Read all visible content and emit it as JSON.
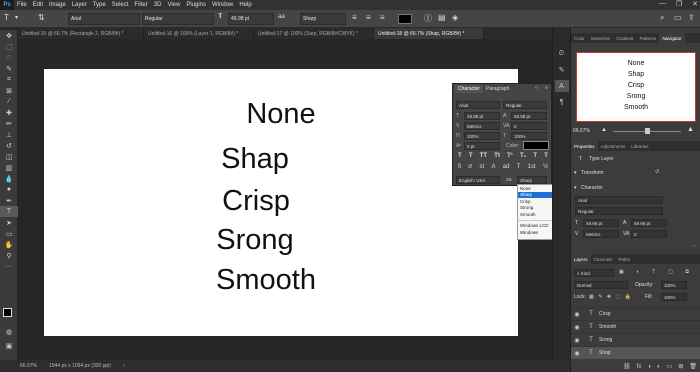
{
  "app": {
    "logo": "Ps"
  },
  "menubar": {
    "items": [
      "File",
      "Edit",
      "Image",
      "Layer",
      "Type",
      "Select",
      "Filter",
      "3D",
      "View",
      "Plugins",
      "Window",
      "Help"
    ]
  },
  "options": {
    "font_family": "Arial",
    "font_style": "Regular",
    "font_size": "49.98 pt",
    "aa_label": "aa",
    "aa_value": "Sharp"
  },
  "tabs": [
    {
      "label": "Untitled-15 @ 66.7% (Rectangle 2, RGB/8#) *"
    },
    {
      "label": "Untitled-16 @ 100% (Layer 1, RGB/8#) *"
    },
    {
      "label": "Untitled-17 @ 100% (Sarp, RGB/8#/CMYK) *"
    },
    {
      "label": "Untitled-18 @ 66.7% (Shap, RGB/8#) *"
    }
  ],
  "canvas": {
    "lines": [
      "None",
      "Shap",
      "Crisp",
      "Srong",
      "Smooth"
    ]
  },
  "status": {
    "zoom": "66.67%",
    "doc_info": "1944 px x 1094 px (300 ppi)"
  },
  "character_panel": {
    "tab_character": "Character",
    "tab_paragraph": "Paragraph",
    "font_family": "Arial",
    "font_style": "Regular",
    "size": "49.98 pt",
    "leading": "59.98 pt",
    "kerning": "Metrics",
    "tracking": "0",
    "vscale": "100%",
    "hscale": "100%",
    "baseline": "0 pt",
    "color_label": "Color:",
    "language": "English: USA",
    "aa_label": "aa",
    "aa_value": "Sharp"
  },
  "aa_menu": {
    "items": [
      "None",
      "Sharp",
      "Crisp",
      "Strong",
      "Smooth",
      "Windows LCD",
      "Windows"
    ],
    "selected": "Sharp"
  },
  "right": {
    "top_tabs": [
      "Color",
      "Swatches",
      "Gradient",
      "Patterns",
      "Navigator"
    ],
    "nav_lines": [
      "None",
      "Shap",
      "Crisp",
      "Srong",
      "Smooth"
    ],
    "nav_zoom": "66.67%",
    "props_tabs": [
      "Properties",
      "Adjustments",
      "Libraries"
    ],
    "type_layer": "Type Layer",
    "transform": "Transform",
    "character": "Character",
    "font_family": "Arial",
    "font_style": "Regular",
    "size": "49.98 pt",
    "leading": "59.98 pt",
    "kerning": "Metrics",
    "tracking": "0",
    "layers_tabs": [
      "Layers",
      "Channels",
      "Paths"
    ],
    "kind": "Kind",
    "blend": "Normal",
    "opacity_label": "Opacity:",
    "opacity": "100%",
    "lock_label": "Lock:",
    "fill_label": "Fill:",
    "fill": "100%",
    "layers": [
      {
        "name": "Crisp"
      },
      {
        "name": "Smooth"
      },
      {
        "name": "Srong"
      },
      {
        "name": "Shap"
      }
    ]
  }
}
